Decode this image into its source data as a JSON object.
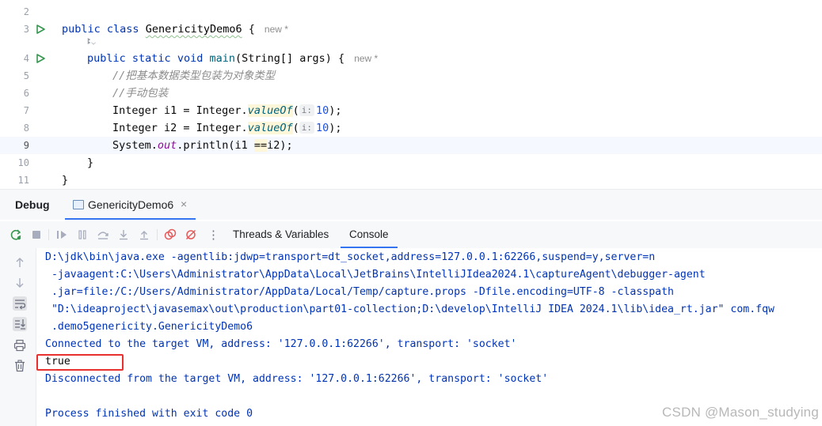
{
  "editor": {
    "lines": [
      {
        "num": "2"
      },
      {
        "num": "3",
        "kw1": "public",
        "kw2": "class",
        "cls": "GenericityDemo6",
        "brace": " {",
        "badge": "new *"
      },
      {
        "num": "4",
        "kw1": "public",
        "kw2": "static",
        "kw3": "void",
        "fn": "main",
        "params": "(String[] args) {",
        "badge": "new *"
      },
      {
        "num": "5",
        "comment": "//把基本数据类型包装为对象类型"
      },
      {
        "num": "6",
        "comment": "//手动包装"
      },
      {
        "num": "7",
        "pre": "Integer i1 = Integer.",
        "method": "valueOf",
        "open": "(",
        "hint": "i:",
        "arg": "10",
        "close": ");"
      },
      {
        "num": "8",
        "pre": "Integer i2 = Integer.",
        "method": "valueOf",
        "open": "(",
        "hint": "i:",
        "arg": "10",
        "close": ");"
      },
      {
        "num": "9",
        "pre": "System.",
        "field": "out",
        "mid": ".println(i1 ",
        "op": "==",
        "post": "i2);"
      },
      {
        "num": "10",
        "text": "}"
      },
      {
        "num": "11",
        "text": "}"
      }
    ],
    "author_glyph": "ꔪ⌄"
  },
  "debug": {
    "title": "Debug",
    "session_tab": "GenericityDemo6",
    "close_glyph": "×",
    "toolbar": {
      "tabs": [
        "Threads & Variables",
        "Console"
      ],
      "active_tab": "Console",
      "more_glyph": "⋮"
    },
    "sidebar_icons": [
      "arrow-up-icon",
      "arrow-down-icon",
      "soft-wrap-icon",
      "scroll-to-end-icon",
      "print-icon",
      "trash-icon"
    ]
  },
  "console": {
    "lines": [
      "D:\\jdk\\bin\\java.exe -agentlib:jdwp=transport=dt_socket,address=127.0.0.1:62266,suspend=y,server=n",
      " -javaagent:C:\\Users\\Administrator\\AppData\\Local\\JetBrains\\IntelliJIdea2024.1\\captureAgent\\debugger-agent",
      " .jar=file:/C:/Users/Administrator/AppData/Local/Temp/capture.props -Dfile.encoding=UTF-8 -classpath",
      " \"D:\\ideaproject\\javasemax\\out\\production\\part01-collection;D:\\develop\\IntelliJ IDEA 2024.1\\lib\\idea_rt.jar\" com.fqw",
      " .demo5genericity.GenericityDemo6",
      "Connected to the target VM, address: '127.0.0.1:62266', transport: 'socket'",
      "true",
      "Disconnected from the target VM, address: '127.0.0.1:62266', transport: 'socket'",
      "",
      "Process finished with exit code 0"
    ]
  },
  "watermark": "CSDN @Mason_studying",
  "colors": {
    "keyword": "#0033b3",
    "comment": "#8c8c8c",
    "accent": "#3574f0",
    "highlight_box": "#e8312f",
    "run_icon": "#369650"
  }
}
